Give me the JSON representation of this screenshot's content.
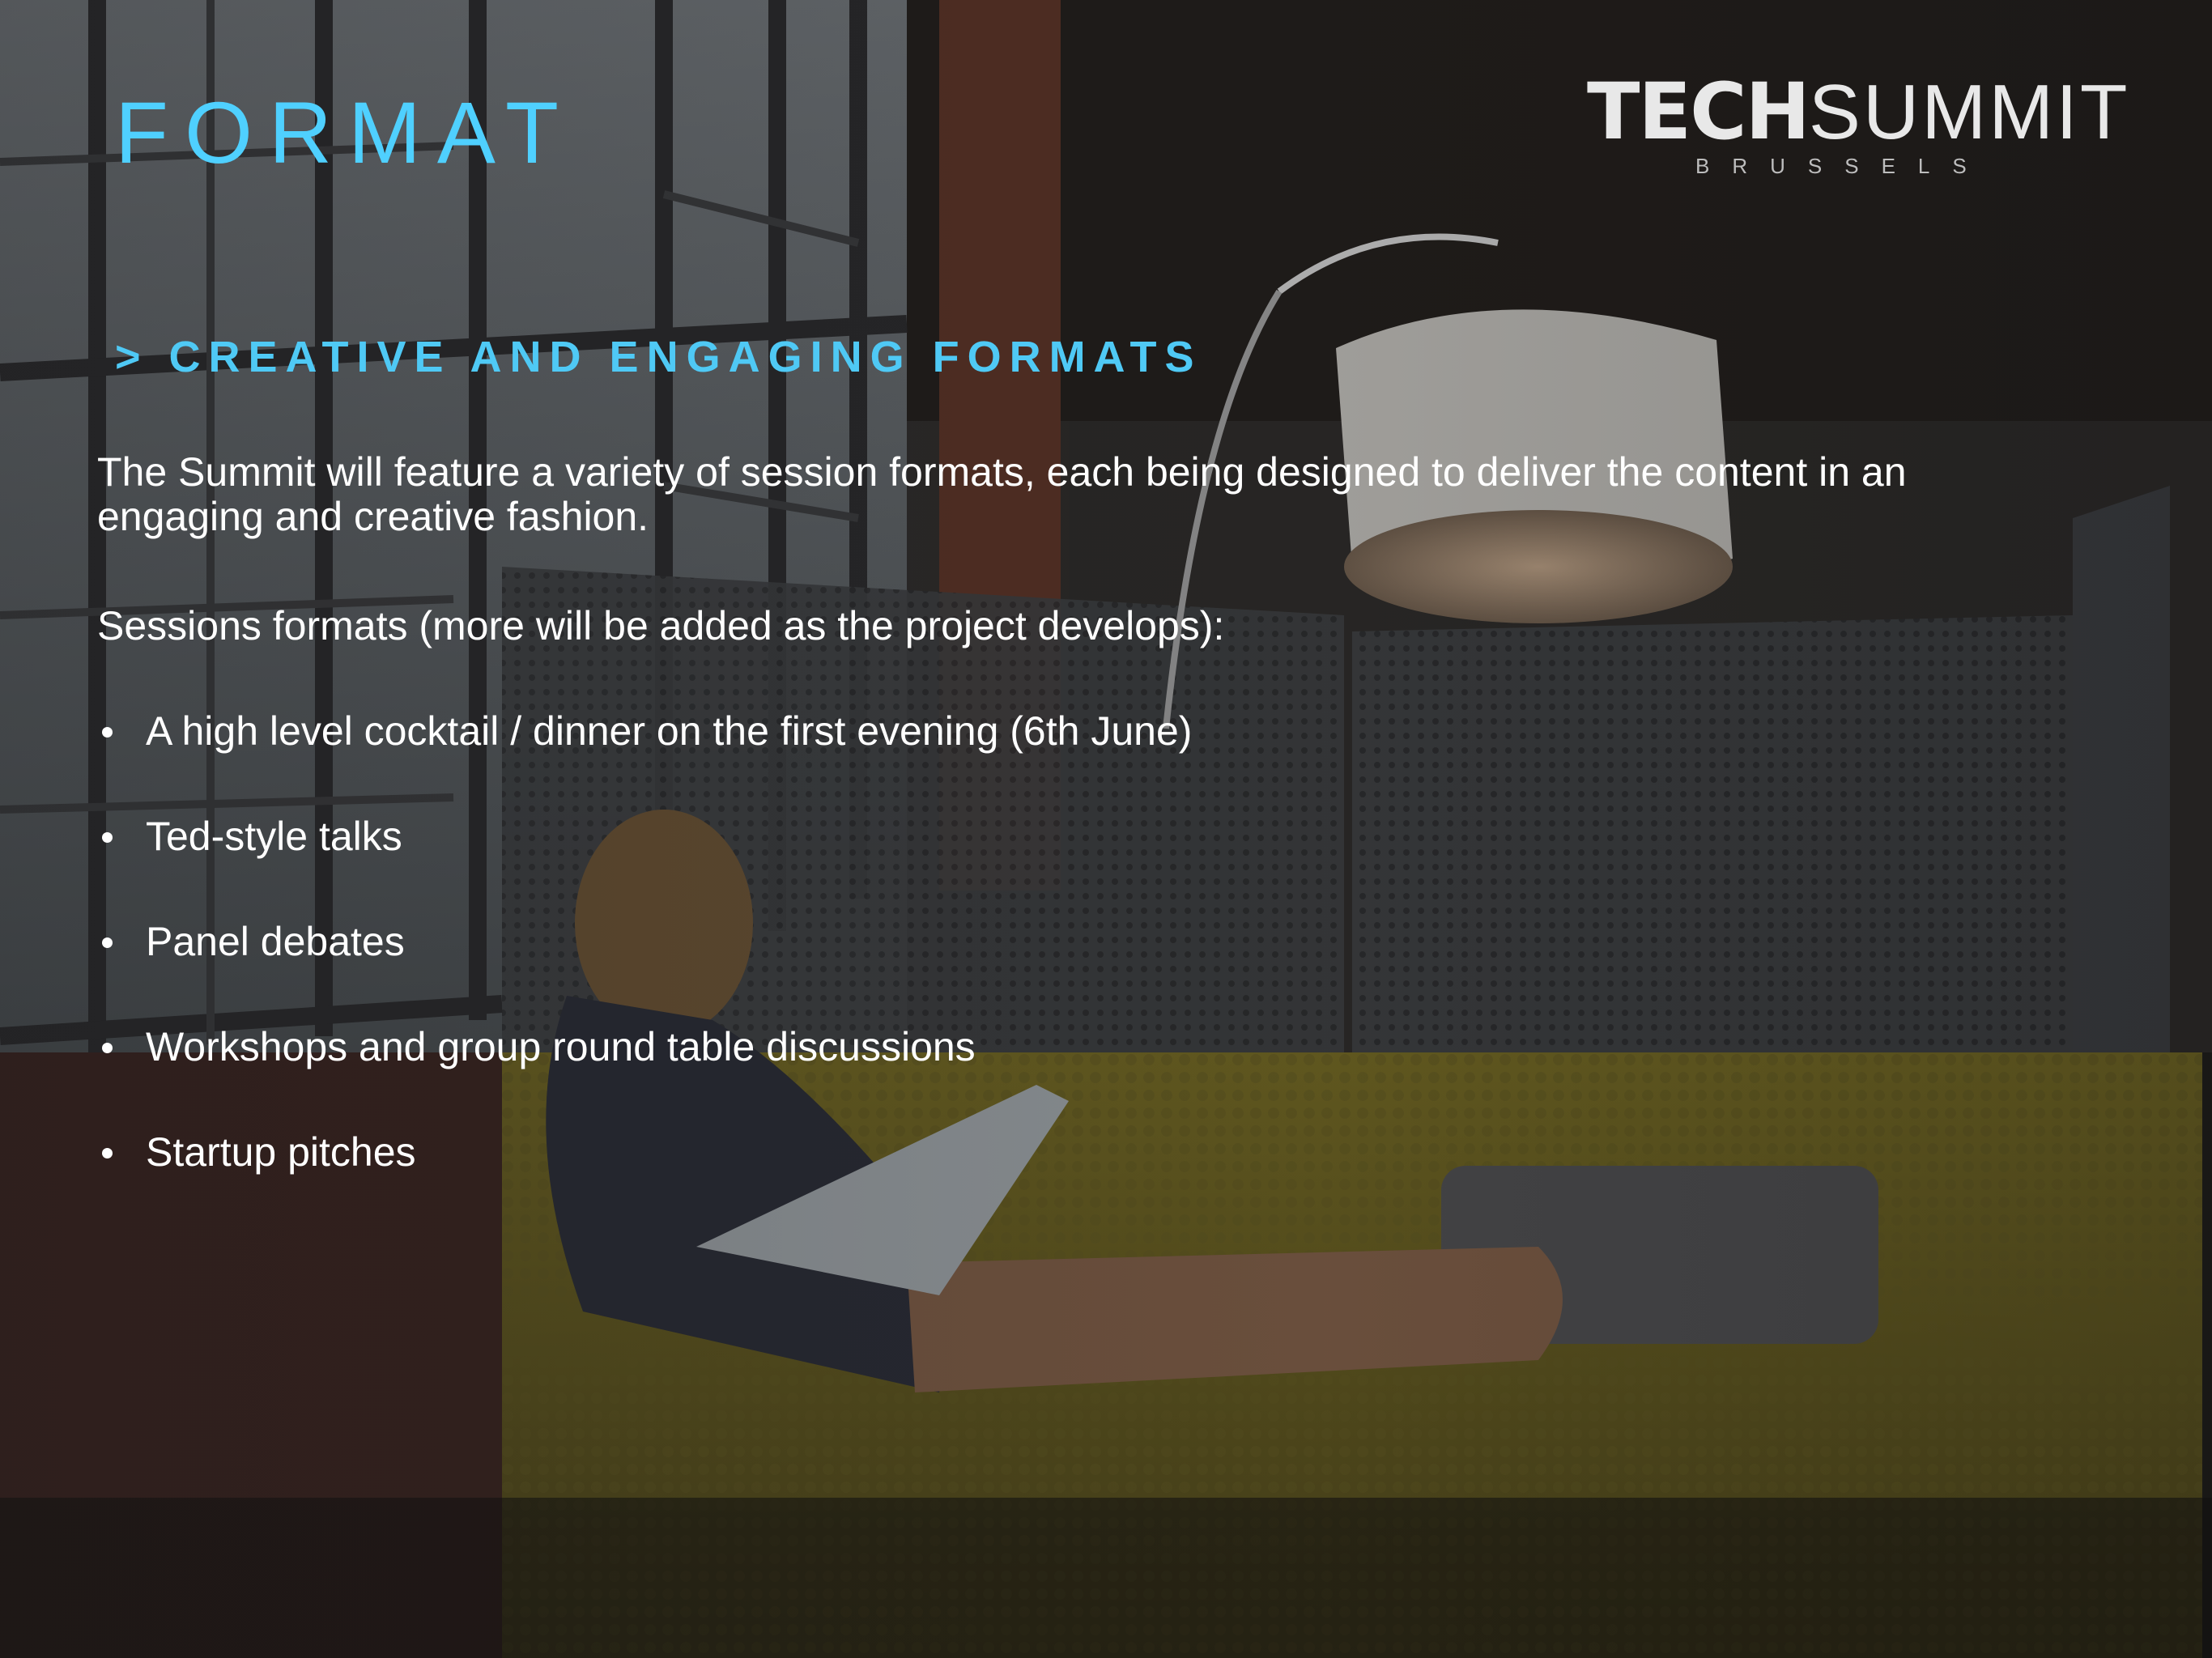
{
  "slide": {
    "title": "FORMAT",
    "logo": {
      "primary": "TECH",
      "secondary": "SUMMIT",
      "location": "BRUSSELS"
    },
    "subtitle": "> CREATIVE AND ENGAGING FORMATS",
    "intro": "The Summit will feature a variety of session formats, each being designed to deliver the content in an engaging and creative fashion.",
    "sessions_label": "Sessions formats (more will be added as the project develops):",
    "bullets": [
      "A high level cocktail / dinner on the first evening (6th June)",
      "Ted-style talks",
      "Panel debates",
      "Workshops and group round table discussions",
      "Startup pitches"
    ]
  },
  "colors": {
    "title": "#4fd0ff",
    "subtitle": "#4fc9f5",
    "body_text": "#ffffff",
    "logo": "#e8e8e8"
  }
}
